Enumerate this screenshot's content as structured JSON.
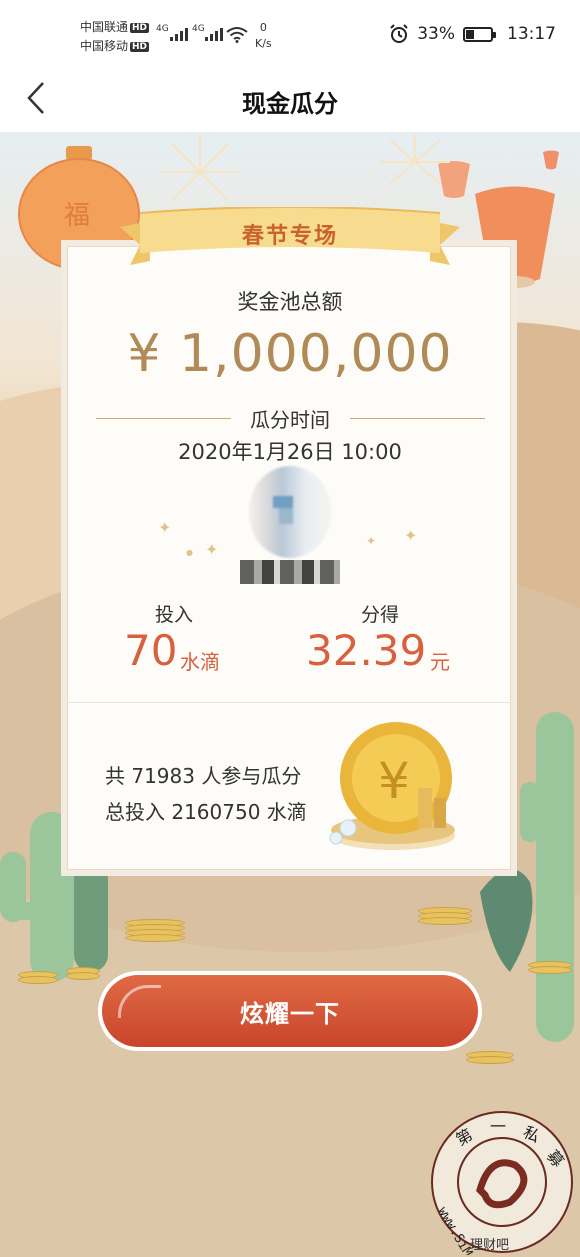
{
  "status_bar": {
    "carrier_1": "中国联通",
    "carrier_2": "中国移动",
    "hd_badge": "HD",
    "net_type": "4G",
    "net_speed_value": "0",
    "net_speed_unit": "K/s",
    "battery_percent": "33%",
    "battery_level": 0.33,
    "time": "13:17"
  },
  "header": {
    "title": "现金瓜分",
    "back_icon": "chevron-left-icon"
  },
  "event": {
    "ribbon_title": "春节专场",
    "pool_label": "奖金池总额",
    "pool_amount": "¥ 1,000,000",
    "time_label": "瓜分时间",
    "time_value": "2020年1月26日 10:00"
  },
  "stats": {
    "invest_label": "投入",
    "invest_value": "70",
    "invest_unit": "水滴",
    "earn_label": "分得",
    "earn_value": "32.39",
    "earn_unit": "元"
  },
  "summary": {
    "participants": "共 71983 人参与瓜分",
    "total_invest": "总投入 2160750 水滴"
  },
  "cta": {
    "label": "炫耀一下"
  },
  "watermark": {
    "chars": [
      "第",
      "一",
      "私",
      "募"
    ],
    "url": "www.SiMu001.cn",
    "overlay": "理财吧"
  },
  "colors": {
    "accent": "#d9603f",
    "gold": "#b08a57",
    "ribbon": "#f5d889",
    "cta": "#c9452c"
  }
}
